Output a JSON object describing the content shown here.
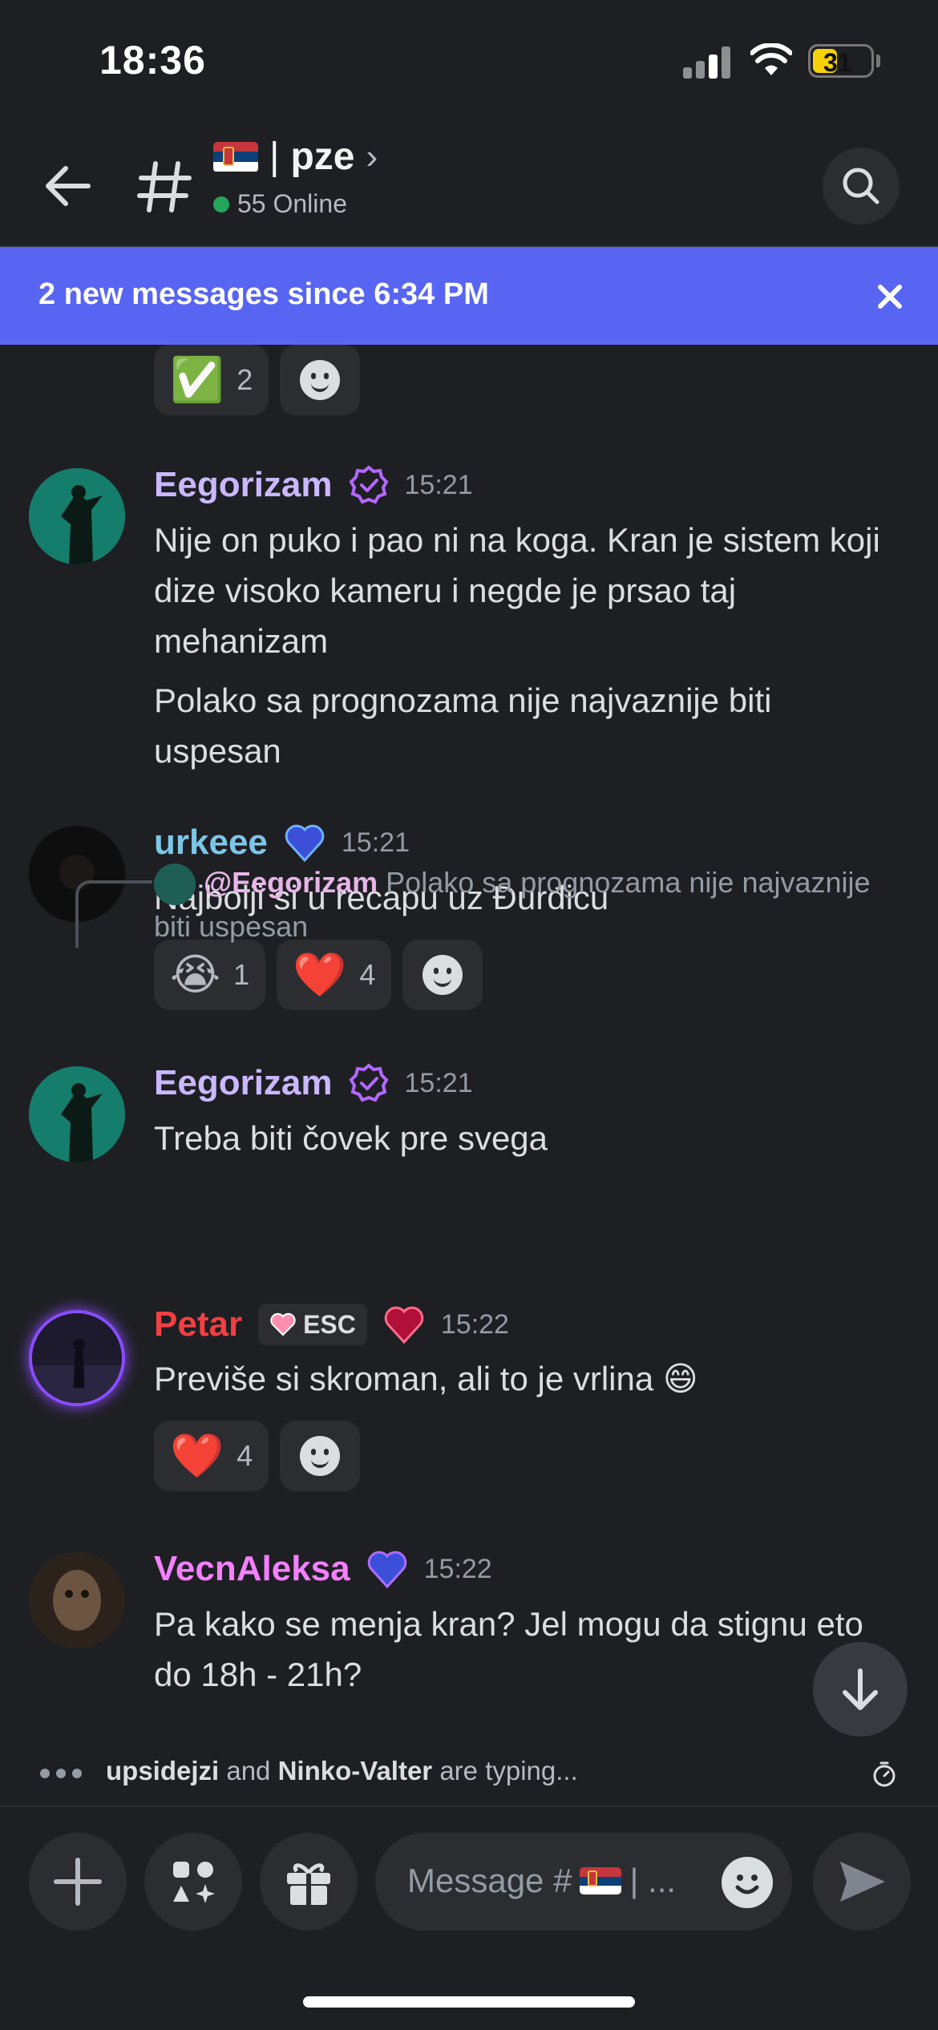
{
  "status_bar": {
    "time": "18:36",
    "battery": "31"
  },
  "header": {
    "channel_name": "pze",
    "channel_divider": "|",
    "online_count": "55 Online"
  },
  "banner": {
    "text": "2 new messages since 6:34 PM"
  },
  "messages": [
    {
      "reactions_only": true,
      "reactions": [
        {
          "emoji": "✅",
          "count": "2"
        }
      ]
    },
    {
      "username": "Eegorizam",
      "color": "#c9b8ff",
      "time": "15:21",
      "lines": [
        "Nije on puko i pao ni na koga. Kran je sistem koji dize visoko kameru i negde je prsao taj mehanizam",
        "Polako sa prognozama nije najvaznije biti uspesan"
      ]
    },
    {
      "username": "urkeee",
      "color": "#7cc6e6",
      "time": "15:21",
      "lines": [
        "Najbolji si u recapu uz Đurđicu"
      ],
      "reactions": [
        {
          "emoji": "😭",
          "count": "1"
        },
        {
          "emoji": "❤️",
          "count": "4"
        }
      ]
    },
    {
      "username": "Eegorizam",
      "color": "#c9b8ff",
      "time": "15:21",
      "lines": [
        "Treba biti čovek pre svega"
      ]
    },
    {
      "reply_to": {
        "name": "@Eegorizam",
        "text": "Polako sa prognozama nije najvaznije biti uspesan"
      },
      "username": "Petar",
      "color": "#f23f43",
      "time": "15:22",
      "tag": "ESC",
      "lines": [
        "Previše si skroman, ali to je vrlina 😄"
      ],
      "reactions": [
        {
          "emoji": "❤️",
          "count": "4"
        }
      ]
    },
    {
      "username": "VecnAleksa",
      "color": "#f47fff",
      "time": "15:22",
      "lines": [
        "Pa kako se menja kran? Jel mogu da stignu eto do 18h - 21h?"
      ]
    }
  ],
  "typing": {
    "user1": "upsidejzi",
    "and": " and ",
    "user2": "Ninko-Valter",
    "suffix": " are typing..."
  },
  "composer": {
    "placeholder_prefix": "Message #",
    "placeholder_suffix": "| ..."
  },
  "colors": {
    "accent": "#5865f2",
    "background": "#1e1f23",
    "online": "#23a55a"
  },
  "icons": [
    "back-arrow-icon",
    "hash-icon",
    "search-icon",
    "close-icon",
    "plus-icon",
    "apps-icon",
    "gift-icon",
    "emoji-icon",
    "send-icon",
    "arrow-down-icon",
    "timer-icon",
    "verified-badge-icon",
    "blue-heart-icon"
  ]
}
